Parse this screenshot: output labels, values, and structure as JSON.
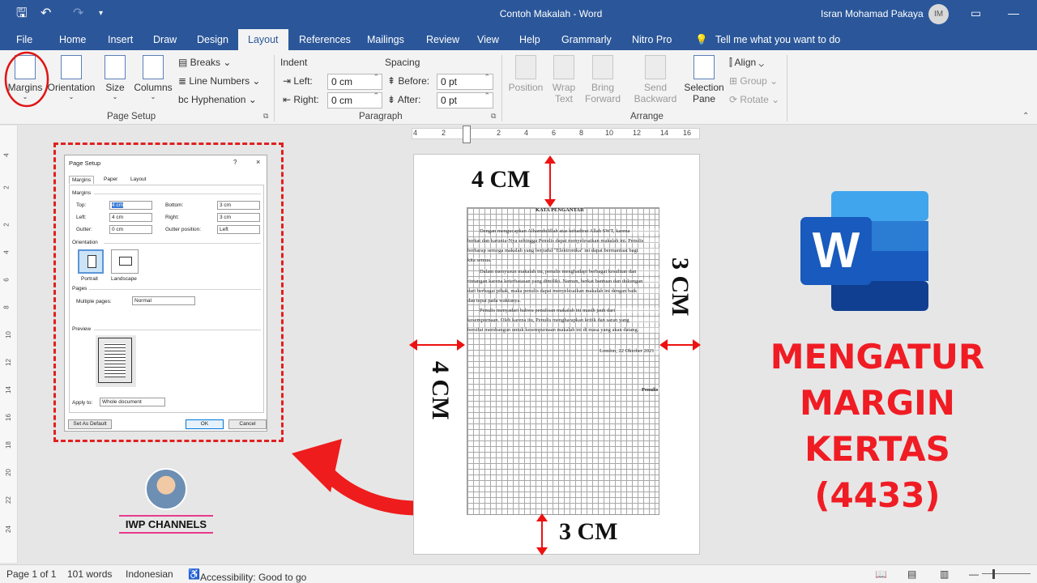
{
  "window": {
    "title": "Contoh Makalah  -  Word",
    "user_name": "Isran Mohamad Pakaya",
    "user_initials": "IM"
  },
  "tabs": [
    {
      "label": "File"
    },
    {
      "label": "Home"
    },
    {
      "label": "Insert"
    },
    {
      "label": "Draw"
    },
    {
      "label": "Design"
    },
    {
      "label": "Layout"
    },
    {
      "label": "References"
    },
    {
      "label": "Mailings"
    },
    {
      "label": "Review"
    },
    {
      "label": "View"
    },
    {
      "label": "Help"
    },
    {
      "label": "Grammarly"
    },
    {
      "label": "Nitro Pro"
    },
    {
      "label": "Tell me what you want to do"
    }
  ],
  "ribbon": {
    "margins": "Margins",
    "orientation": "Orientation",
    "size": "Size",
    "columns": "Columns",
    "breaks": "Breaks",
    "line_numbers": "Line Numbers",
    "hyphenation": "Hyphenation",
    "page_setup_label": "Page Setup",
    "indent_label": "Indent",
    "left_label": "Left:",
    "left_value": "0 cm",
    "right_label": "Right:",
    "right_value": "0 cm",
    "spacing_label": "Spacing",
    "before_label": "Before:",
    "before_value": "0 pt",
    "after_label": "After:",
    "after_value": "0 pt",
    "paragraph_label": "Paragraph",
    "position_1": "Position",
    "wrap_text_1": "Wrap",
    "wrap_text_2": "Text",
    "bring_1": "Bring",
    "bring_2": "Forward",
    "send_1": "Send",
    "send_2": "Backward",
    "selection_1": "Selection",
    "selection_2": "Pane",
    "align": "Align",
    "group": "Group",
    "rotate": "Rotate",
    "arrange_label": "Arrange"
  },
  "dialog": {
    "title": "Page Setup",
    "help": "?",
    "close": "×",
    "tabs": [
      "Margins",
      "Paper",
      "Layout"
    ],
    "margins_section": "Margins",
    "top_label": "Top:",
    "top_value": "4 cm",
    "bottom_label": "Bottom:",
    "bottom_value": "3 cm",
    "left_label": "Left:",
    "left_value": "4 cm",
    "right_label": "Right:",
    "right_value": "3 cm",
    "gutter_label": "Gutter:",
    "gutter_value": "0 cm",
    "gutter_pos_label": "Gutter position:",
    "gutter_pos_value": "Left",
    "orientation_section": "Orientation",
    "portrait": "Portrait",
    "landscape": "Landscape",
    "pages_section": "Pages",
    "multiple_pages_label": "Multiple pages:",
    "multiple_pages_value": "Normal",
    "preview_section": "Preview",
    "apply_to_label": "Apply to:",
    "apply_to_value": "Whole document",
    "set_default": "Set As Default",
    "ok": "OK",
    "cancel": "Cancel"
  },
  "document": {
    "heading": "KATA PENGANTAR",
    "line1": "Dengan mengucapkan Alhamdulillah atas kehadirat Allah SWT, karena",
    "line2": "berkat dan karunia-Nya sehingga Penulis dapat menyelesaikan makalah ini. Penulis",
    "line3": "berharap semoga makalah yang berjudul \"Elektronika\" ini dapat bermanfaat bagi",
    "line4": "kita semua.",
    "line5": "Dalam menyusun makalah ini, penulis menghadapi berbagai kesulitan dan",
    "line6": "rintangan karena keterbatasan yang dimiliki. Namun, berkat bantuan dan dukungan",
    "line7": "dari berbagai pihak, maka penulis dapat menyelesaikan makalah ini dengan baik",
    "line8": "dan tepat pada waktunya.",
    "line9": "Penulis menyadari bahwa penulisan makalah ini masih jauh dari",
    "line10": "kesempurnaan. Oleh karena itu, Penulis mengharapkan kritik dan saran yang",
    "line11": "bersifat membangun untuk kesempurnaan makalah ini di masa yang akan datang.",
    "place_date": "London, 22 Oktober 2021",
    "signature": "Penulis"
  },
  "annotations": {
    "top": "4 CM",
    "left": "4 CM",
    "right": "3 CM",
    "bottom": "3 CM"
  },
  "banner": {
    "line1": "MENGATUR",
    "line2": "MARGIN KERTAS",
    "line3": "(4433)"
  },
  "channel": "IWP CHANNELS",
  "status": {
    "page": "Page 1 of 1",
    "words": "101 words",
    "language": "Indonesian",
    "accessibility": "Accessibility: Good to go"
  },
  "ruler": {
    "h_ticks": [
      "4",
      "2",
      "2",
      "4",
      "6",
      "8",
      "10",
      "12",
      "14",
      "16"
    ],
    "v_ticks": [
      "4",
      "2",
      "2",
      "4",
      "6",
      "8",
      "10",
      "12",
      "14",
      "16",
      "18",
      "20",
      "22",
      "24"
    ]
  },
  "colors": {
    "titlebar": "#2b579a",
    "accent_red": "#f01c24",
    "word_blue": "#185abd"
  }
}
